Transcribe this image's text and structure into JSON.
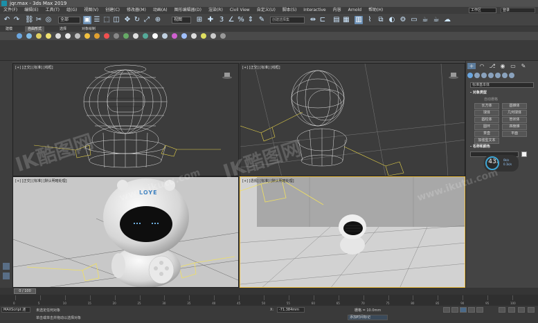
{
  "window": {
    "title": "jqr.max - 3ds Max 2019"
  },
  "menu": [
    "文件(F)",
    "编辑(E)",
    "工具(T)",
    "组(G)",
    "视图(V)",
    "创建(C)",
    "修改器(M)",
    "动画(A)",
    "图形编辑器(D)",
    "渲染(R)",
    "Civil View",
    "自定义(U)",
    "脚本(S)",
    "Interactive",
    "内容",
    "Arnold",
    "帮助(H)"
  ],
  "workspace": "工作区",
  "login": "登录",
  "toolbar": {
    "selection_filter": "全部",
    "reference_coord": "视图",
    "named_selection": "创建选择集"
  },
  "ribbon_tabs": [
    {
      "label": "建模",
      "active": false
    },
    {
      "label": "自由形式",
      "active": true
    },
    {
      "label": "选择",
      "active": false
    },
    {
      "label": "对象绘制",
      "active": false
    }
  ],
  "viewports": [
    {
      "id": "top-left",
      "label": "[+] [正交] [标准] [线框]"
    },
    {
      "id": "top-right",
      "label": "[+] [正交] [标准] [线框]"
    },
    {
      "id": "bottom-left",
      "label": "[+] [正交] [标准] [默认明暗处理]"
    },
    {
      "id": "bottom-right",
      "label": "[+] [透视] [标准] [默认明暗处理]"
    }
  ],
  "robot_logo": "LOYE",
  "command_panel": {
    "category_dropdown": "标准基本体",
    "object_type_title": "- 对象类型",
    "auto_grid": "自动栅格",
    "object_buttons": [
      "长方体",
      "圆锥体",
      "球体",
      "几何球体",
      "圆柱体",
      "管状体",
      "圆环",
      "四棱锥",
      "茶壶",
      "平面",
      "加强型文本"
    ],
    "name_color_title": "- 名称和颜色"
  },
  "perf_badge": {
    "value": "43",
    "unit": "x",
    "rate1": "0k/s",
    "rate2": "0.1k/s"
  },
  "timeline": {
    "frame_label": "0 / 100",
    "ticks": [
      "0",
      "5",
      "10",
      "15",
      "20",
      "25",
      "30",
      "35",
      "40",
      "45",
      "50",
      "55",
      "60",
      "65",
      "70",
      "75",
      "80",
      "85",
      "90",
      "95",
      "100"
    ]
  },
  "status": {
    "script_listener": "MAXScript 迷",
    "selected": "未选定任何对象",
    "x_label": "X:",
    "x_value": "-71.384mm",
    "grid": "栅格 = 10.0mm",
    "add_time_tag": "添加时间标记",
    "hint": "单击或单击并拖动以选择对象"
  },
  "watermarks": [
    "IK酷图网",
    "www.ikutu.com",
    "IK酷图网",
    "www.ikutu.com"
  ]
}
